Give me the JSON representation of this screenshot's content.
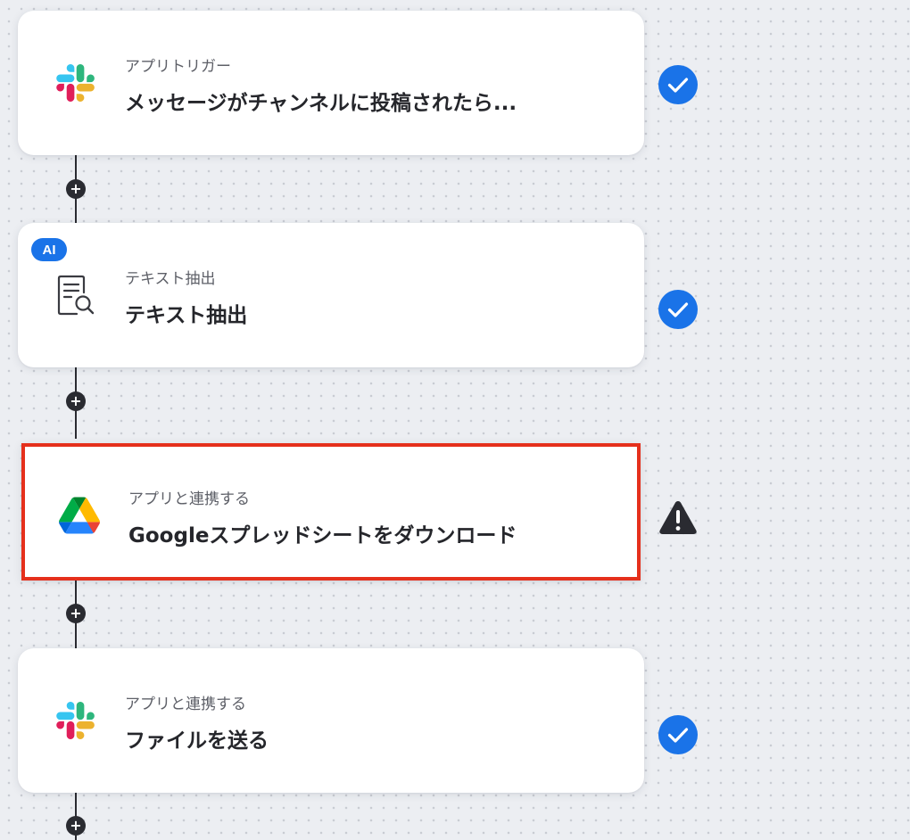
{
  "flow": {
    "steps": [
      {
        "category": "アプリトリガー",
        "title": "メッセージがチャンネルに投稿されたら...",
        "app_icon": "slack-icon",
        "status": "completed",
        "ai": false
      },
      {
        "category": "テキスト抽出",
        "title": "テキスト抽出",
        "app_icon": "document-search-icon",
        "status": "completed",
        "ai": true,
        "ai_label": "AI"
      },
      {
        "category": "アプリと連携する",
        "title": "Googleスプレッドシートをダウンロード",
        "app_icon": "google-drive-icon",
        "status": "warning",
        "ai": false,
        "selected": true
      },
      {
        "category": "アプリと連携する",
        "title": "ファイルを送る",
        "app_icon": "slack-icon",
        "status": "completed",
        "ai": false
      }
    ],
    "add_step_symbol": "+"
  },
  "colors": {
    "completed": "#1a73e8",
    "warning": "#2a2b31",
    "highlight": "#e5301c",
    "connector": "#2a2b31"
  }
}
